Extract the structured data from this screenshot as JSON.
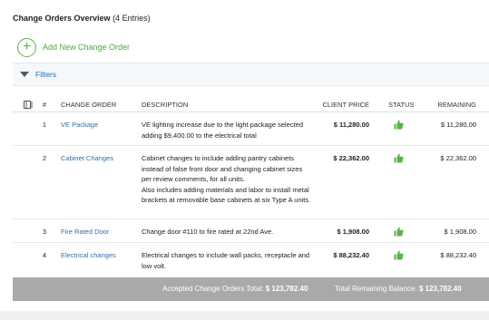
{
  "header": {
    "title": "Change Orders Overview",
    "count": "(4 Entries)"
  },
  "actions": {
    "add_label": "Add New Change Order"
  },
  "filters": {
    "label": "Filters"
  },
  "table": {
    "columns": {
      "num": "#",
      "name": "CHANGE ORDER",
      "desc": "DESCRIPTION",
      "price": "CLIENT PRICE",
      "status": "STATUS",
      "remaining": "REMAINING"
    },
    "rows": [
      {
        "num": "1",
        "name": "VE Package",
        "desc": "VE lighting increase due to the light package selected adding $9,400.00 to the electrical total",
        "price": "$ 11,280.00",
        "status": "approved",
        "remaining": "$ 11,280.00"
      },
      {
        "num": "2",
        "name": "Cabinet Changes",
        "desc": "Cabinet changes to include adding pantry cabinets instead of false front door and changing cabinet sizes per review comments, for all units.",
        "desc2": "Also includes adding materials and labor to install metal brackets at removable base cabinets at six Type A units.",
        "price": "$ 22,362.00",
        "status": "approved",
        "remaining": "$ 22,362.00"
      },
      {
        "num": "3",
        "name": "Fire Rated Door",
        "desc": "Change door #110 to fire rated at 22nd Ave.",
        "price": "$ 1,908.00",
        "status": "approved",
        "remaining": "$ 1,908.00"
      },
      {
        "num": "4",
        "name": "Electrical changes",
        "desc": "Electrical changes to include wall packs, receptacle and low volt.",
        "price": "$ 88,232.40",
        "status": "approved",
        "remaining": "$ 88,232.40"
      }
    ]
  },
  "totals": {
    "accepted_label": "Accepted Change Orders Total:",
    "accepted_value": "$ 123,782.40",
    "remaining_label": "Total Remaining Balance:",
    "remaining_value": "$ 123,782.40"
  },
  "colors": {
    "accent_green": "#5bb349",
    "link_blue": "#2f6fb0",
    "totals_bar": "#a9a9a9"
  },
  "icons": {
    "add": "plus-circle-icon",
    "filters": "triangle-down-icon",
    "columns": "columns-icon",
    "status": "thumbs-up-icon"
  }
}
